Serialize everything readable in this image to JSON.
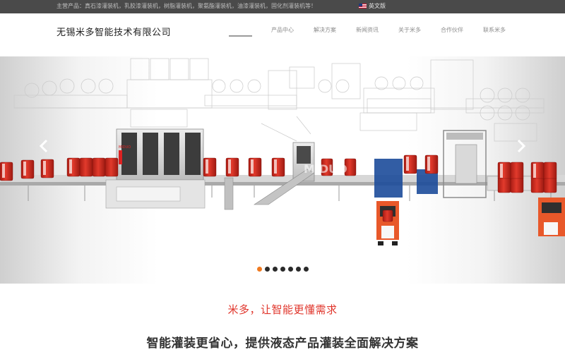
{
  "topbar": {
    "products": "主营产品：真石漆灌装机，乳胶漆灌装机，树脂灌装机，聚氨酯灌装机，油漆灌装机，固化剂灌装机等！",
    "language_label": "英文版"
  },
  "header": {
    "company_name": "无锡米多智能技术有限公司",
    "nav": [
      {
        "label": "产品中心"
      },
      {
        "label": "解决方案"
      },
      {
        "label": "新闻资讯"
      },
      {
        "label": "关于米多"
      },
      {
        "label": "合作伙伴"
      },
      {
        "label": "联系米多"
      }
    ]
  },
  "banner": {
    "watermark": "MIDUO",
    "machine_brand": "MIDUO",
    "slide_count": 7,
    "active_slide": 1
  },
  "colors": {
    "accent_red": "#e0352b",
    "drum_red": "#d42a1f",
    "forklift_orange": "#e8582a",
    "active_dot": "#f07a20",
    "topbar_bg": "#4a4a4a"
  },
  "content": {
    "slogan_red": "米多，让智能更懂需求",
    "slogan_main": "智能灌装更省心，提供液态产品灌装全面解决方案"
  }
}
